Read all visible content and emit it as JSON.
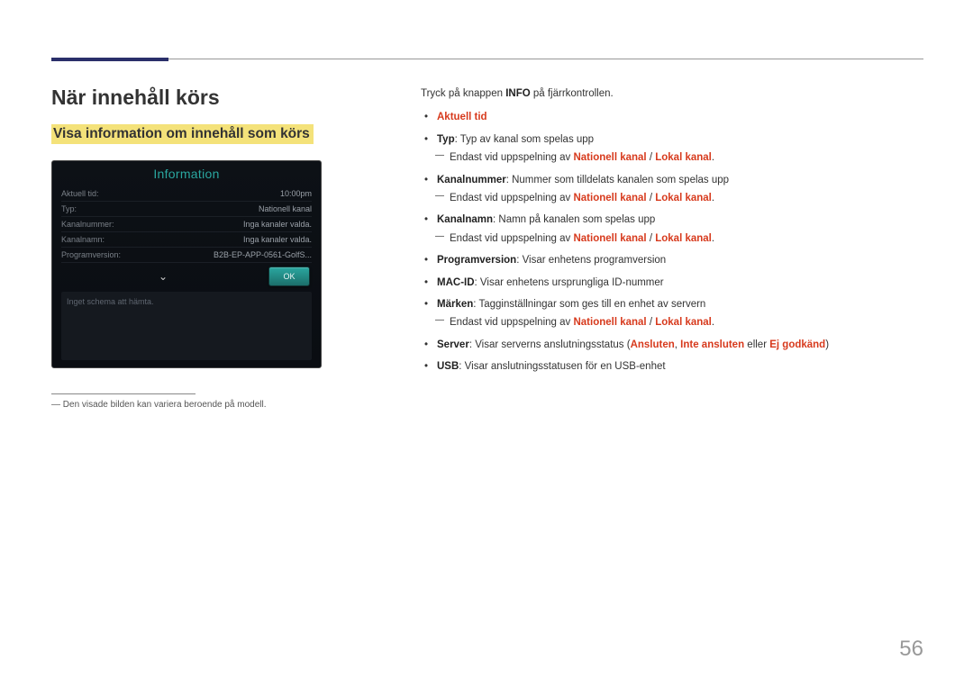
{
  "page_number": "56",
  "heading_main": "När innehåll körs",
  "heading_sub": "Visa information om innehåll som körs",
  "info_panel": {
    "title": "Information",
    "rows": [
      {
        "label": "Aktuell tid:",
        "value": "10:00pm"
      },
      {
        "label": "Typ:",
        "value": "Nationell kanal"
      },
      {
        "label": "Kanalnummer:",
        "value": "Inga kanaler valda."
      },
      {
        "label": "Kanalnamn:",
        "value": "Inga kanaler valda."
      },
      {
        "label": "Programversion:",
        "value": "B2B-EP-APP-0561-GolfS..."
      }
    ],
    "ok_label": "OK",
    "message": "Inget schema att hämta."
  },
  "footnote": "Den visade bilden kan variera beroende på modell.",
  "intro": {
    "prefix": "Tryck på knappen ",
    "bold": "INFO",
    "suffix": " på fjärrkontrollen."
  },
  "bullets": {
    "b1": "Aktuell tid",
    "b2_bold": "Typ",
    "b2_rest": ": Typ av kanal som spelas upp",
    "sub_text": "Endast vid uppspelning av ",
    "sub_red1": "Nationell kanal",
    "sub_slash": " / ",
    "sub_red2": "Lokal kanal",
    "sub_period": ".",
    "b3_bold": "Kanalnummer",
    "b3_rest": ": Nummer som tilldelats kanalen som spelas upp",
    "b4_bold": "Kanalnamn",
    "b4_rest": ": Namn på kanalen som spelas upp",
    "b5_bold": "Programversion",
    "b5_rest": ": Visar enhetens programversion",
    "b6_bold": "MAC-ID",
    "b6_rest": ": Visar enhetens ursprungliga ID-nummer",
    "b7_bold": "Märken",
    "b7_rest": ": Tagginställningar som ges till en enhet av servern",
    "b8_bold": "Server",
    "b8_rest": ": Visar serverns anslutningsstatus (",
    "b8_red1": "Ansluten",
    "b8_comma": ", ",
    "b8_red2": "Inte ansluten",
    "b8_or": " eller ",
    "b8_red3": "Ej godkänd",
    "b8_end": ")",
    "b9_bold": "USB",
    "b9_rest": ": Visar anslutningsstatusen för en USB-enhet"
  }
}
